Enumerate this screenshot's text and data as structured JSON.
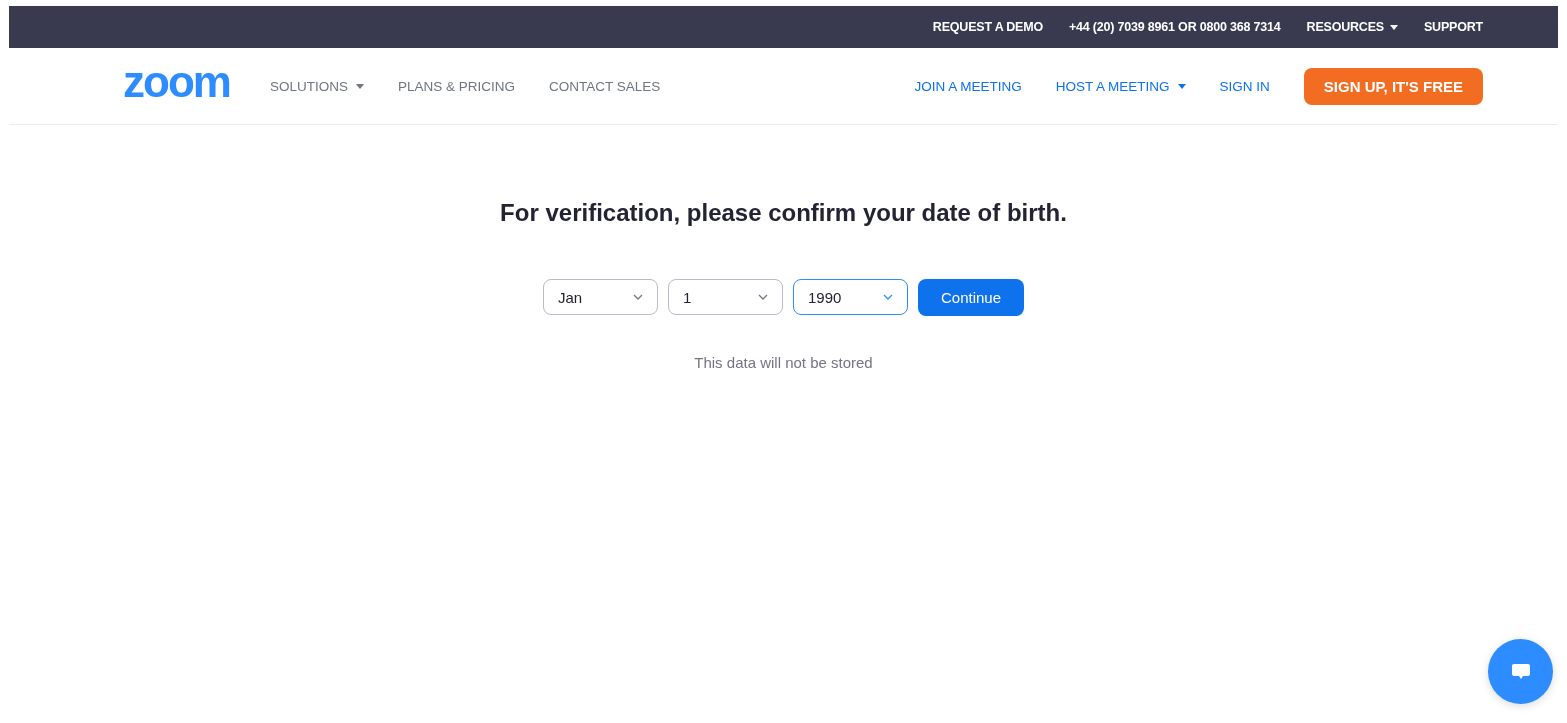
{
  "top_bar": {
    "links": [
      {
        "label": "REQUEST A DEMO",
        "dropdown": false
      },
      {
        "label": "+44 (20) 7039 8961 OR 0800 368 7314",
        "dropdown": false
      },
      {
        "label": "RESOURCES",
        "dropdown": true
      },
      {
        "label": "SUPPORT",
        "dropdown": false
      }
    ]
  },
  "nav": {
    "logo": "zoom",
    "left_links": [
      {
        "label": "SOLUTIONS",
        "dropdown": true
      },
      {
        "label": "PLANS & PRICING",
        "dropdown": false
      },
      {
        "label": "CONTACT SALES",
        "dropdown": false
      }
    ],
    "right_links": [
      {
        "label": "JOIN A MEETING",
        "dropdown": false
      },
      {
        "label": "HOST A MEETING",
        "dropdown": true
      },
      {
        "label": "SIGN IN",
        "dropdown": false
      }
    ],
    "signup_button": "SIGN UP, IT'S FREE"
  },
  "verification": {
    "heading": "For verification, please confirm your date of birth.",
    "selects": [
      {
        "value": "Jan",
        "focused": false
      },
      {
        "value": "1",
        "focused": false
      },
      {
        "value": "1990",
        "focused": true
      }
    ],
    "button": "Continue",
    "note": "This data will not be stored"
  }
}
